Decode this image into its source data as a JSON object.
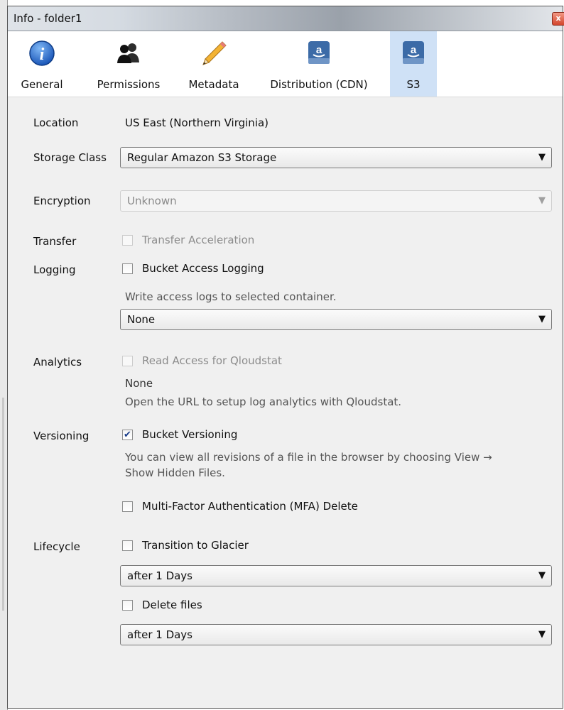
{
  "window": {
    "title": "Info - folder1",
    "close_label": "x"
  },
  "tabs": [
    {
      "label": "General",
      "icon": "info-icon"
    },
    {
      "label": "Permissions",
      "icon": "users-icon"
    },
    {
      "label": "Metadata",
      "icon": "pencil-icon"
    },
    {
      "label": "Distribution (CDN)",
      "icon": "amazon-drive-icon"
    },
    {
      "label": "S3",
      "icon": "amazon-drive-icon",
      "active": true
    }
  ],
  "fields": {
    "location": {
      "label": "Location",
      "value": "US East (Northern Virginia)"
    },
    "storage_class": {
      "label": "Storage Class",
      "value": "Regular Amazon S3 Storage"
    },
    "encryption": {
      "label": "Encryption",
      "value": "Unknown"
    },
    "transfer": {
      "label": "Transfer",
      "checkbox": "Transfer Acceleration",
      "checked": false
    },
    "logging": {
      "label": "Logging",
      "checkbox": "Bucket Access Logging",
      "checked": false,
      "hint": "Write access logs to selected container.",
      "container": "None"
    },
    "analytics": {
      "label": "Analytics",
      "checkbox": "Read Access for Qloudstat",
      "checked": false,
      "value": "None",
      "hint": "Open the URL to setup log analytics with Qloudstat."
    },
    "versioning": {
      "label": "Versioning",
      "checkbox": "Bucket Versioning",
      "checked": true,
      "hint_line1": "You can view all revisions of a file in the browser by choosing View →",
      "hint_line2": "Show Hidden Files.",
      "mfa_checkbox": "Multi-Factor Authentication (MFA) Delete",
      "mfa_checked": false
    },
    "lifecycle": {
      "label": "Lifecycle",
      "glacier_checkbox": "Transition to Glacier",
      "glacier_checked": false,
      "glacier_after": "after 1 Days",
      "delete_checkbox": "Delete files",
      "delete_checked": false,
      "delete_after": "after 1 Days"
    }
  },
  "colors": {
    "active_tab": "#cfe1f6",
    "checkmark": "#1a3d8a",
    "amazon_drive": "#3c6ba7"
  }
}
